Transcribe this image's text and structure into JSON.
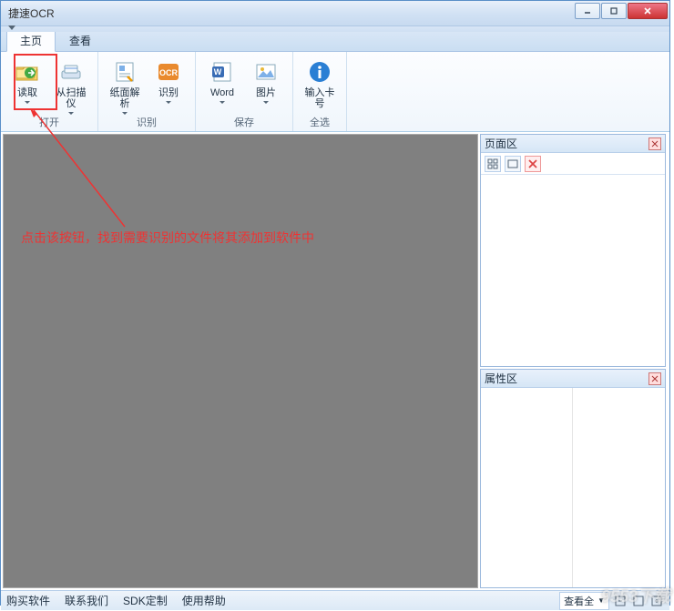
{
  "window": {
    "title": "捷速OCR"
  },
  "tabs": {
    "home": "主页",
    "view": "查看"
  },
  "ribbon": {
    "open": {
      "label": "打开",
      "read": "读取",
      "scanner": "从扫描仪"
    },
    "recognize": {
      "label": "识别",
      "page_parse": "纸面解析",
      "ocr": "识别"
    },
    "save": {
      "label": "保存",
      "word": "Word",
      "image": "图片"
    },
    "selectall": {
      "label": "全选",
      "input_card": "输入卡号"
    }
  },
  "annotation": "点击该按钮，找到需要识别的文件将其添加到软件中",
  "panels": {
    "pages": "页面区",
    "props": "属性区"
  },
  "status": {
    "buy": "购买软件",
    "contact": "联系我们",
    "sdk": "SDK定制",
    "help": "使用帮助",
    "view_all": "查看全"
  },
  "watermark": "9553下载"
}
